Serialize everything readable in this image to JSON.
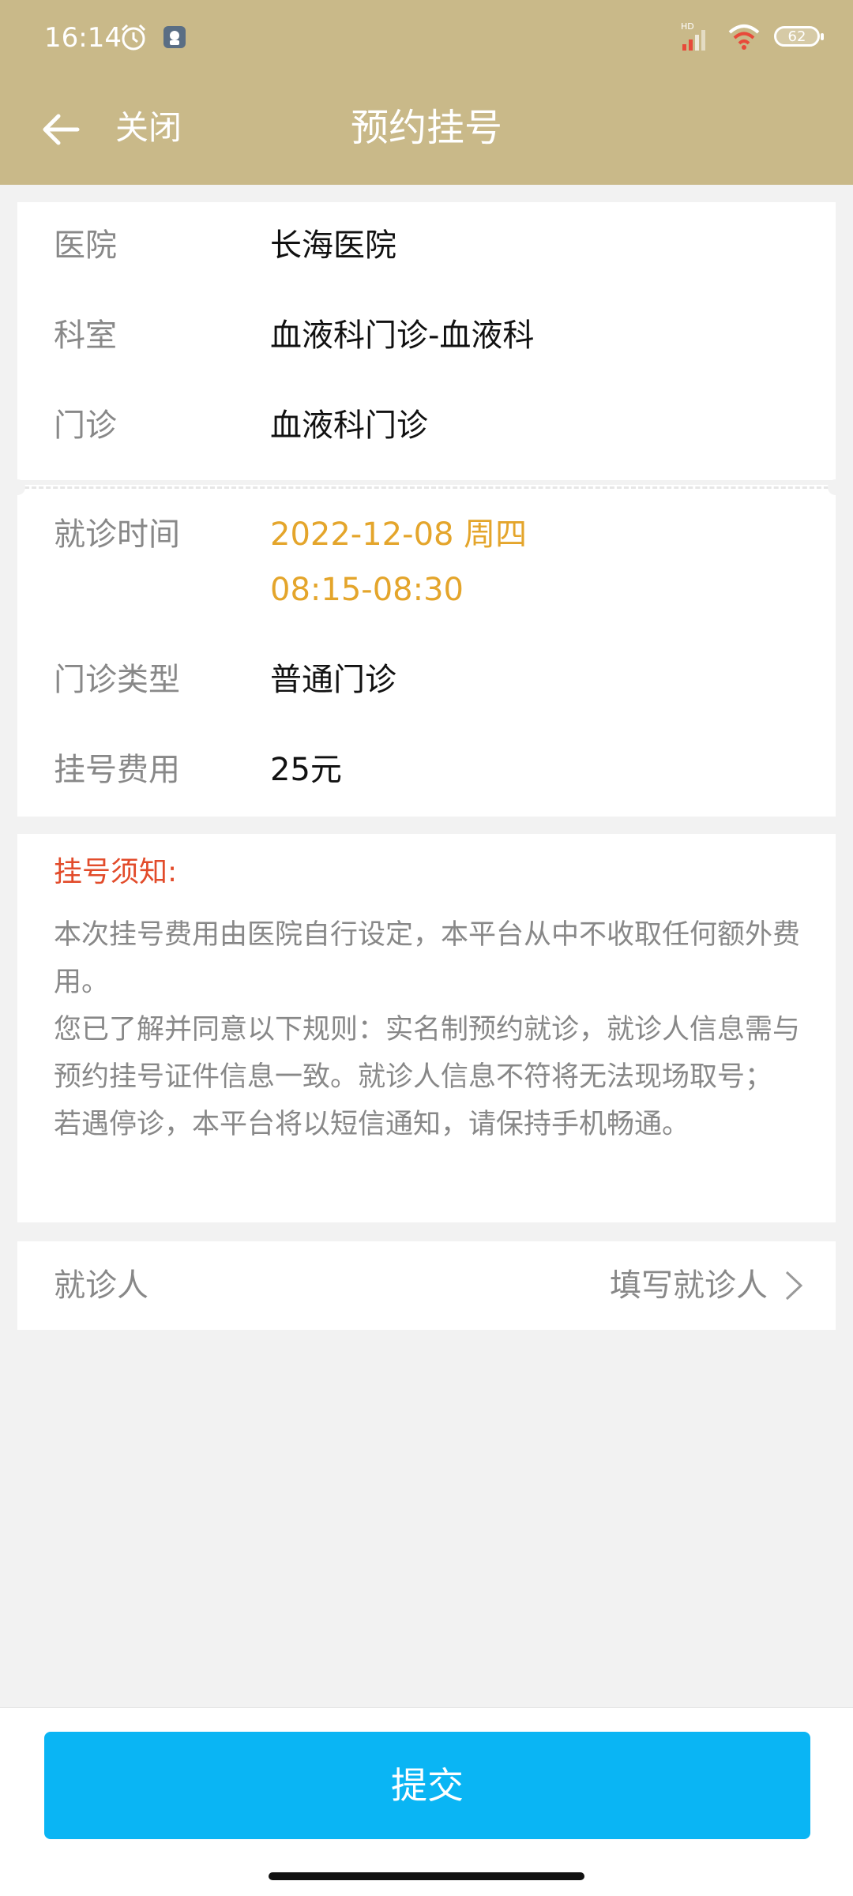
{
  "status_bar": {
    "time": "16:14",
    "battery": "62",
    "network": "HD"
  },
  "title_bar": {
    "close_label": "关闭",
    "title": "预约挂号"
  },
  "hospital_info": {
    "hospital_label": "医院",
    "hospital_value": "长海医院",
    "department_label": "科室",
    "department_value": "血液科门诊-血液科",
    "clinic_label": "门诊",
    "clinic_value": "血液科门诊"
  },
  "visit_info": {
    "time_label": "就诊时间",
    "date_value": "2022-12-08  周四",
    "time_value": "08:15-08:30",
    "type_label": "门诊类型",
    "type_value": "普通门诊",
    "fee_label": "挂号费用",
    "fee_value": "25元"
  },
  "notice": {
    "title": "挂号须知:",
    "paragraph1": "本次挂号费用由医院自行设定，本平台从中不收取任何额外费用。",
    "paragraph2": "您已了解并同意以下规则：实名制预约就诊，就诊人信息需与预约挂号证件信息一致。就诊人信息不符将无法现场取号；",
    "paragraph3": "若遇停诊，本平台将以短信通知，请保持手机畅通。"
  },
  "patient": {
    "label": "就诊人",
    "action_label": "填写就诊人"
  },
  "submit": {
    "label": "提交"
  },
  "colors": {
    "header_bg": "#c9b989",
    "accent_time": "#e4a52b",
    "notice_title": "#e24b2a",
    "submit_bg": "#0ab5f4"
  }
}
